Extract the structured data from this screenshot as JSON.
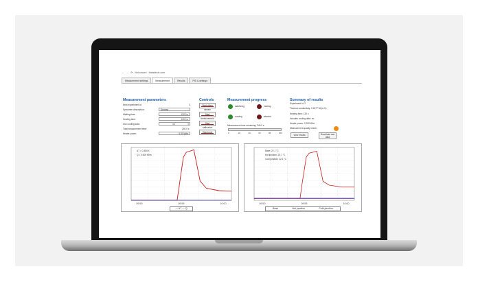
{
  "browser": {
    "nav_glyphs": [
      "←",
      "→",
      "⟳"
    ],
    "url_prefix": "Not secure",
    "url": "thelabhub.com"
  },
  "tabs": [
    "Measurement settings",
    "Measurement",
    "Results",
    "PID & settings"
  ],
  "params": {
    "title": "Measurement parameters",
    "rows": [
      {
        "label": "Next experiment id:",
        "value": "3"
      },
      {
        "label": "Specimen description:",
        "value": "Dummy"
      },
      {
        "label": "Waiting time:",
        "value": "120.0 s"
      },
      {
        "label": "Heating time:",
        "value": "120.0 s"
      },
      {
        "label": "Use cooling data:",
        "value": "no"
      },
      {
        "label": "Total measurement time:",
        "value": "240.0 s"
      },
      {
        "label": "Heater power:",
        "value": "0.00 W/m"
      }
    ]
  },
  "controls": {
    "title": "Controls",
    "buttons": [
      "Start video stream",
      "Start measurement",
      "Start calibration",
      "Stop/reset"
    ]
  },
  "progress": {
    "title": "Measurement progress",
    "lamps": [
      "stabilizing",
      "heating",
      "running",
      "aborted"
    ],
    "remaining_label": "Measurement time remaining: 240.0 s",
    "scale_ticks": [
      "0",
      "20",
      "40",
      "60",
      "80",
      "100"
    ],
    "fraction": 0
  },
  "summary": {
    "title": "Summary of results",
    "lines": [
      "Experiment id: 2",
      "Thermal conductivity: 0.1577 W/(m·K)",
      "Heating time: 120 s",
      "Includes cooling data: no",
      "Heater power: 2.932 W/m",
      "Measurement quality check:"
    ],
    "view_button": "View results",
    "download_button": "Download raw data"
  },
  "chart_left": {
    "annotations": [
      "ΔT = 0.384 K",
      "Q = 0.000 W/m"
    ],
    "legend": "— ΔT — Q",
    "colors": {
      "line": "#c41c1c"
    }
  },
  "chart_right": {
    "annotations": [
      "Base: 22.1 °C",
      "Hot junction: 22.7 °C",
      "Cold junction: 22.1 °C"
    ],
    "legend_items": [
      "Base",
      "Hot junction",
      "Cold junction"
    ],
    "colors": {
      "base": "#2a2a9a",
      "hot": "#c41c1c",
      "cold": "#7a3aa8"
    }
  },
  "chart_data": [
    {
      "type": "line",
      "x": [
        0,
        40,
        80,
        110,
        115,
        125,
        132,
        150,
        165,
        180,
        210,
        240
      ],
      "series": [
        {
          "name": "ΔT",
          "values": [
            0,
            0,
            0,
            0,
            0.6,
            1.8,
            2.0,
            2.1,
            0.8,
            0.5,
            0.4,
            0.38
          ]
        },
        {
          "name": "Q",
          "values": [
            0,
            0,
            0,
            0,
            0,
            0,
            0,
            0,
            0,
            0,
            0,
            0
          ]
        }
      ],
      "xticks": [
        "09:50",
        "09:55",
        "10:00"
      ],
      "ylim": [
        0,
        2.2
      ],
      "grid": true,
      "legend": "bottom"
    },
    {
      "type": "line",
      "x": [
        0,
        40,
        80,
        110,
        115,
        125,
        132,
        150,
        165,
        180,
        210,
        240
      ],
      "series": [
        {
          "name": "Base",
          "values": [
            22.1,
            22.1,
            22.1,
            22.1,
            22.1,
            22.1,
            22.1,
            22.1,
            22.1,
            22.1,
            22.1,
            22.1
          ]
        },
        {
          "name": "Hot junction",
          "values": [
            22.1,
            22.1,
            22.1,
            22.1,
            22.9,
            24.3,
            24.5,
            24.6,
            23.0,
            22.8,
            22.7,
            22.7
          ]
        },
        {
          "name": "Cold junction",
          "values": [
            22.1,
            22.1,
            22.1,
            22.1,
            22.1,
            22.1,
            22.1,
            22.1,
            22.1,
            22.1,
            22.1,
            22.1
          ]
        }
      ],
      "xticks": [
        "09:50",
        "09:55",
        "10:00"
      ],
      "ylim": [
        22,
        24.8
      ],
      "grid": true,
      "legend": "bottom"
    }
  ]
}
